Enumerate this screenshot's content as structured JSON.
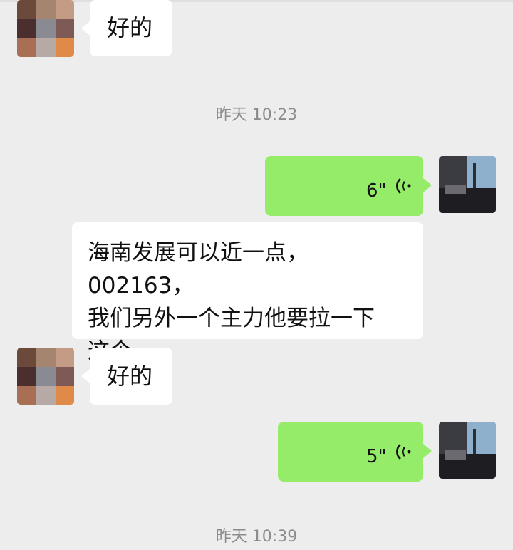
{
  "messages": [
    {
      "type": "text",
      "side": "left",
      "text": "好的"
    },
    {
      "type": "time",
      "text": "昨天 10:23"
    },
    {
      "type": "voice",
      "side": "right",
      "duration": "6\""
    },
    {
      "type": "text",
      "side": "left",
      "lines": [
        "海南发展可以近一点，002163，",
        "我们另外一个主力他要拉一下",
        "这个。"
      ]
    },
    {
      "type": "text",
      "side": "left",
      "text": "好的"
    },
    {
      "type": "voice",
      "side": "right",
      "duration": "5\""
    },
    {
      "type": "time",
      "text": "昨天 10:39"
    }
  ],
  "colors": {
    "background": "#ededed",
    "incoming_bubble": "#ffffff",
    "outgoing_bubble": "#95ec69",
    "timestamp_text": "#8c8c8c"
  },
  "icons": {
    "voice": "voice-wave-icon"
  }
}
